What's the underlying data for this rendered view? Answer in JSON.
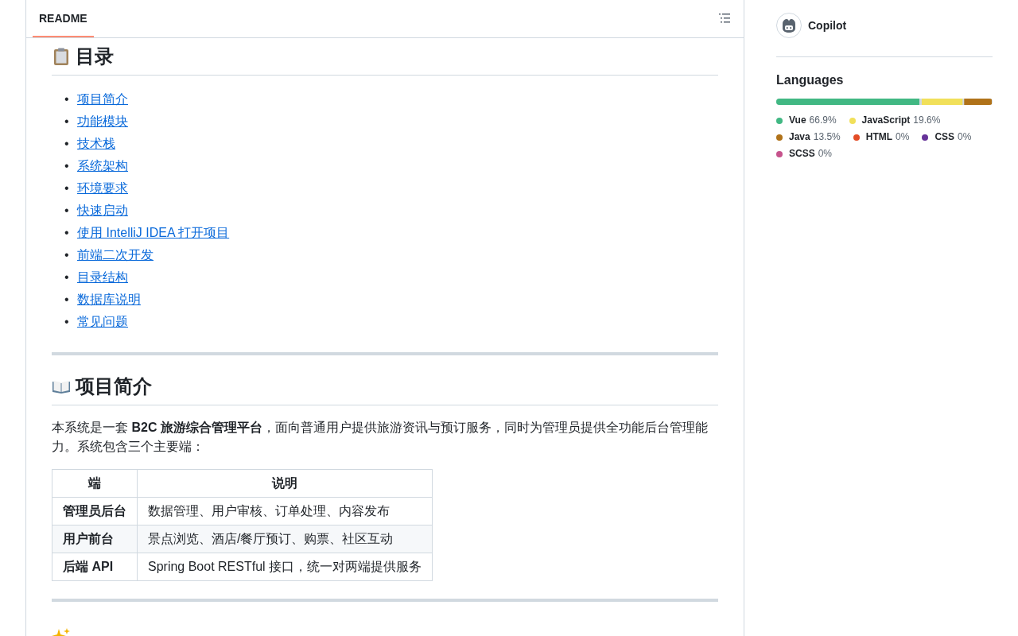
{
  "readme_tab": {
    "label": "README",
    "selected": true
  },
  "toc": {
    "heading": "目录",
    "marker": "•",
    "items": [
      "项目简介",
      "功能模块",
      "技术栈",
      "系统架构",
      "环境要求",
      "快速启动",
      "使用 IntelliJ IDEA 打开项目",
      "前端二次开发",
      "目录结构",
      "数据库说明",
      "常见问题"
    ]
  },
  "intro": {
    "heading": "项目简介",
    "paragraph": "本系统是一套 **B2C 旅游综合管理平台**，面向普通用户提供旅游资讯与预订服务，同时为管理员提供全功能后台管理能力。系统包含三个主要端：",
    "table": {
      "columns": [
        "端",
        "说明"
      ],
      "rows": [
        [
          "管理员后台",
          "数据管理、用户审核、订单处理、内容发布"
        ],
        [
          "用户前台",
          "景点浏览、酒店/餐厅预订、购票、社区互动"
        ],
        [
          "后端 API",
          "Spring Boot RESTful 接口，统一对两端提供服务"
        ]
      ]
    }
  },
  "sidebar": {
    "contributors": [
      {
        "name": "Copilot"
      }
    ],
    "languages": {
      "title": "Languages",
      "items": [
        {
          "name": "Vue",
          "percent": "66.9%",
          "color": "#41b883"
        },
        {
          "name": "JavaScript",
          "percent": "19.6%",
          "color": "#f1e05a"
        },
        {
          "name": "Java",
          "percent": "13.5%",
          "color": "#b07219"
        },
        {
          "name": "HTML",
          "percent": "0%",
          "color": "#e34c26"
        },
        {
          "name": "CSS",
          "percent": "0%",
          "color": "#663399"
        },
        {
          "name": "SCSS",
          "percent": "0%",
          "color": "#c6538c"
        }
      ]
    }
  }
}
